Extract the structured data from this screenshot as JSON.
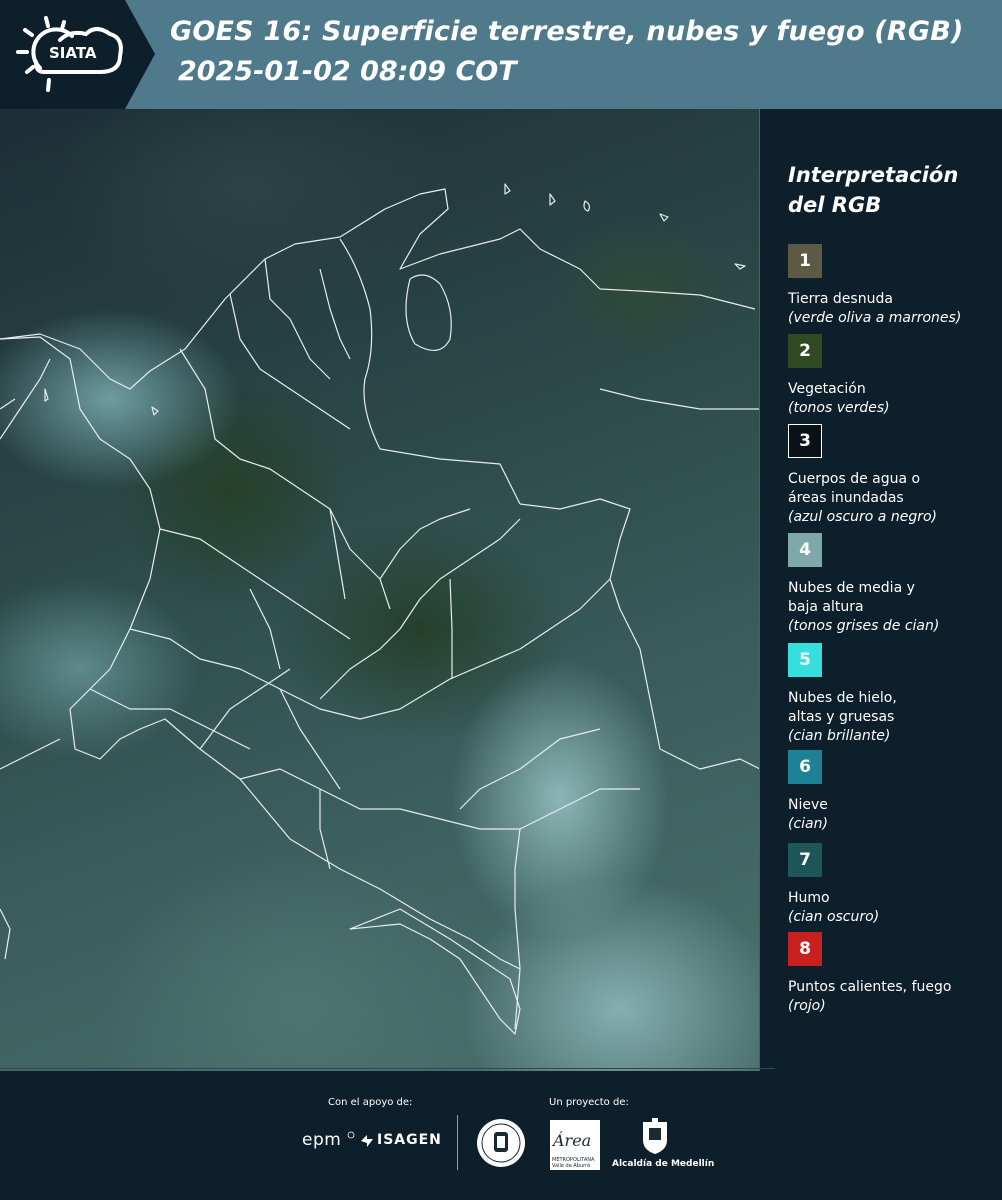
{
  "header": {
    "logo_text": "SIATA",
    "title": "GOES 16: Superficie terrestre, nubes y fuego (RGB)",
    "subtitle": "2025-01-02 08:09 COT"
  },
  "legend": {
    "title_line1": "Interpretación",
    "title_line2": "del RGB",
    "items": [
      {
        "number": "1",
        "label": "Tierra desnuda",
        "note": "(verde oliva a marrones)",
        "color": "#5c5a42"
      },
      {
        "number": "2",
        "label": "Vegetación",
        "note": "(tonos verdes)",
        "color": "#2f4a22"
      },
      {
        "number": "3",
        "label": "Cuerpos de agua o\náreas inundadas",
        "note": "(azul oscuro a negro)",
        "color": "#0a1218"
      },
      {
        "number": "4",
        "label": "Nubes de media y\nbaja altura",
        "note": "(tonos grises de cian)",
        "color": "#7fa9a9"
      },
      {
        "number": "5",
        "label": "Nubes de hielo,\naltas y gruesas",
        "note": "(cian brillante)",
        "color": "#37dede"
      },
      {
        "number": "6",
        "label": "Nieve",
        "note": "(cian)",
        "color": "#1e8296"
      },
      {
        "number": "7",
        "label": "Humo",
        "note": "(cian oscuro)",
        "color": "#1e5558"
      },
      {
        "number": "8",
        "label": "Puntos calientes, fuego",
        "note": "(rojo)",
        "color": "#c8201e"
      }
    ]
  },
  "footer": {
    "support_label": "Con el apoyo de:",
    "project_label": "Un proyecto de:",
    "epm": "epm",
    "isagen": "ISAGEN",
    "area_text": "Área",
    "area_small": "METROPOLITANA Valle de Aburrá",
    "alcaldia": "Alcaldía de Medellín"
  }
}
